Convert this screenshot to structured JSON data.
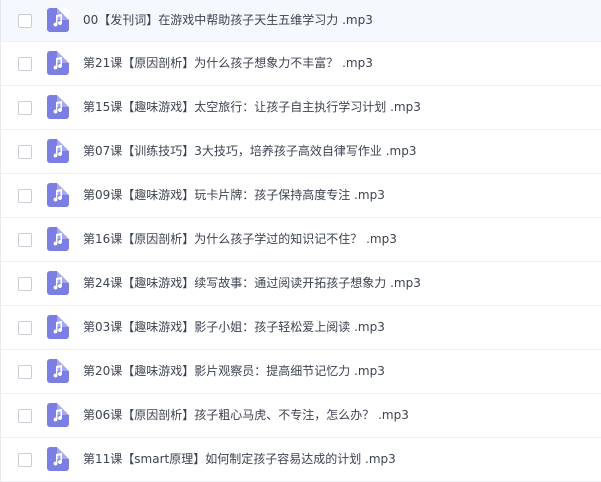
{
  "files": [
    {
      "name": "00【发刊词】在游戏中帮助孩子天生五维学习力 .mp3",
      "icon": "audio-file-icon"
    },
    {
      "name": "第21课【原因剖析】为什么孩子想象力不丰富？ .mp3",
      "icon": "audio-file-icon"
    },
    {
      "name": "第15课【趣味游戏】太空旅行：让孩子自主执行学习计划 .mp3",
      "icon": "audio-file-icon"
    },
    {
      "name": "第07课【训练技巧】3大技巧，培养孩子高效自律写作业 .mp3",
      "icon": "audio-file-icon"
    },
    {
      "name": "第09课【趣味游戏】玩卡片牌：孩子保持高度专注 .mp3",
      "icon": "audio-file-icon"
    },
    {
      "name": "第16课【原因剖析】为什么孩子学过的知识记不住？ .mp3",
      "icon": "audio-file-icon"
    },
    {
      "name": "第24课【趣味游戏】续写故事：通过阅读开拓孩子想象力 .mp3",
      "icon": "audio-file-icon"
    },
    {
      "name": "第03课【趣味游戏】影子小姐：孩子轻松爱上阅读 .mp3",
      "icon": "audio-file-icon"
    },
    {
      "name": "第20课【趣味游戏】影片观察员：提高细节记忆力 .mp3",
      "icon": "audio-file-icon"
    },
    {
      "name": "第06课【原因剖析】孩子粗心马虎、不专注，怎么办？ .mp3",
      "icon": "audio-file-icon"
    },
    {
      "name": "第11课【smart原理】如何制定孩子容易达成的计划 .mp3",
      "icon": "audio-file-icon"
    }
  ],
  "colors": {
    "icon_bg": "#7b7fe3",
    "text": "#3c4350",
    "row_border": "#eef0f3",
    "selected_row_bg": "#f5f8fd"
  }
}
